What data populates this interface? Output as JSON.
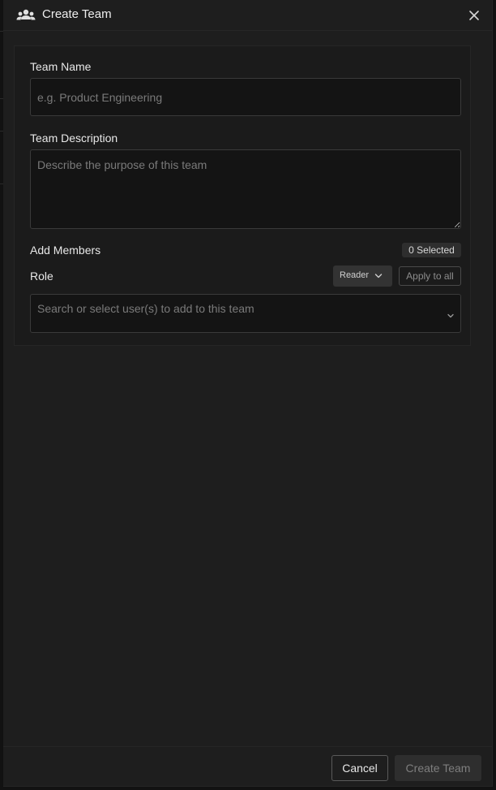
{
  "dialog": {
    "title": "Create Team",
    "header_icon": "team-icon",
    "close_icon": "close-icon"
  },
  "form": {
    "team_name": {
      "label": "Team Name",
      "value": "",
      "placeholder": "e.g. Product Engineering"
    },
    "team_description": {
      "label": "Team Description",
      "value": "",
      "placeholder": "Describe the purpose of this team"
    },
    "members": {
      "label": "Add Members",
      "selected_badge": "0 Selected",
      "role_label": "Role",
      "role_value": "Reader",
      "apply_to_all_label": "Apply to all",
      "search_placeholder": "Search or select user(s) to add to this team"
    }
  },
  "footer": {
    "cancel_label": "Cancel",
    "create_label": "Create Team"
  },
  "colors": {
    "background": "#1e1e1e",
    "input_background": "#141414",
    "border": "#3a3a3a",
    "disabled_button": "#2e2e2e"
  }
}
